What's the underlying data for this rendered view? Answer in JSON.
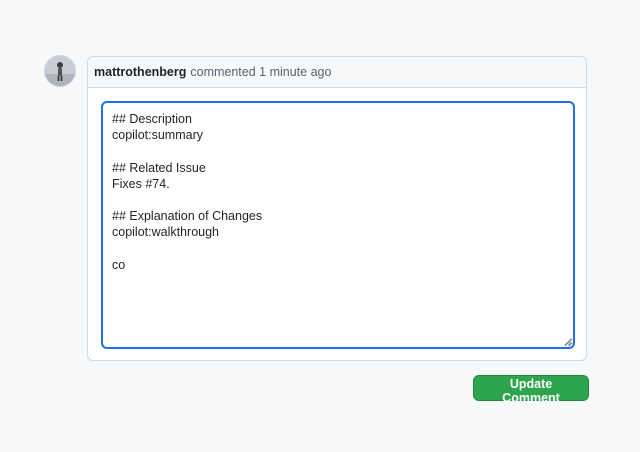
{
  "comment": {
    "author": "mattrothenberg",
    "meta": "commented 1 minute ago",
    "body": "## Description\ncopilot:summary\n\n## Related Issue\nFixes #74.\n\n## Explanation of Changes\ncopilot:walkthrough\n\nco"
  },
  "actions": {
    "update_label": "Update Comment"
  },
  "colors": {
    "focus_border": "#1f6feb",
    "button_green": "#2da44e",
    "page_bg": "#f6f8fa"
  }
}
